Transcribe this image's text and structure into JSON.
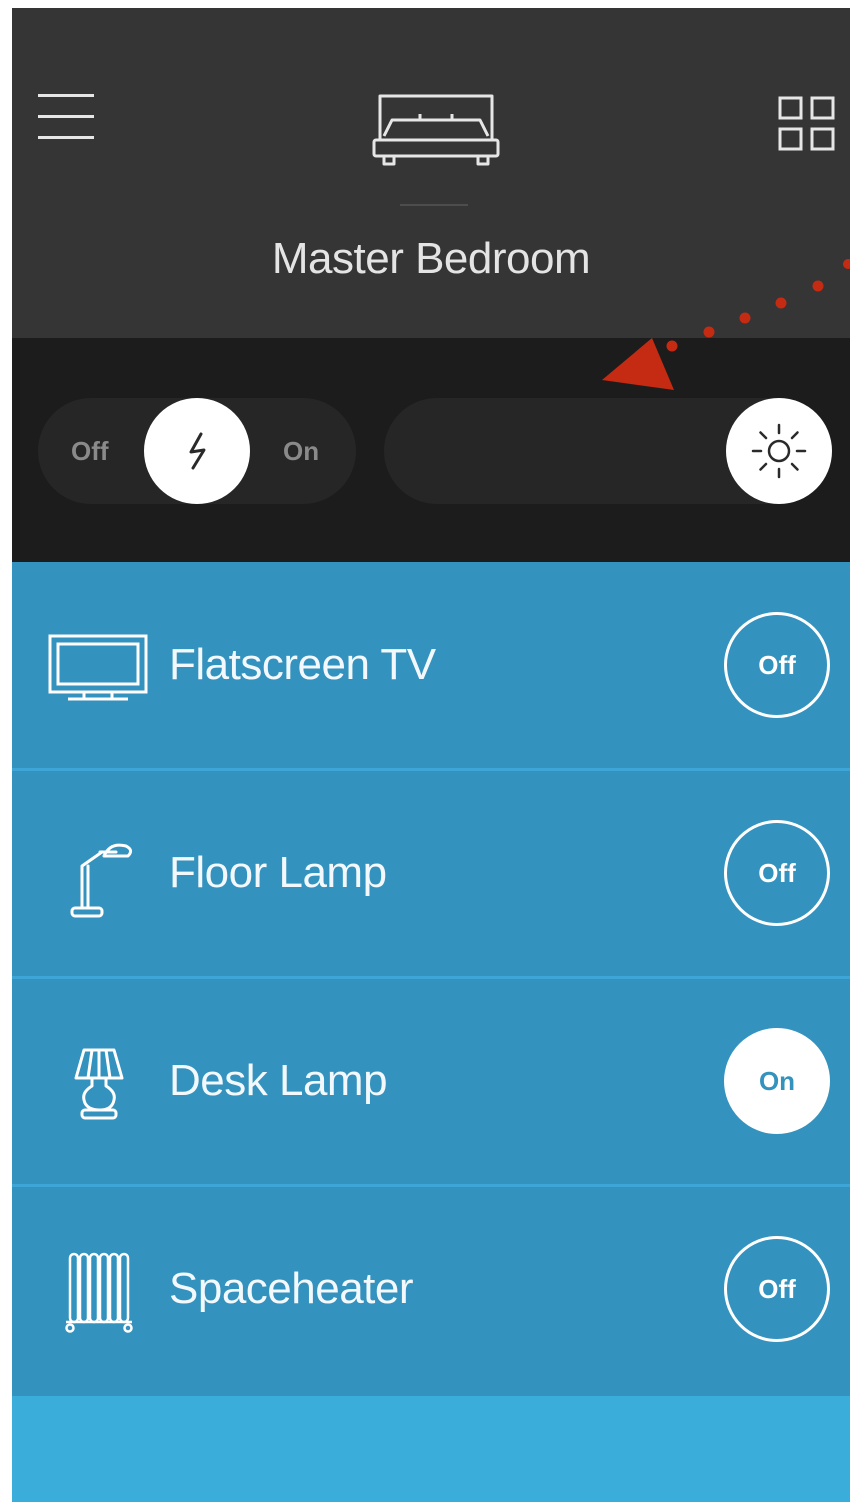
{
  "header": {
    "room_name": "Master Bedroom"
  },
  "controls": {
    "power_off_label": "Off",
    "power_on_label": "On"
  },
  "devices": [
    {
      "label": "Flatscreen TV",
      "state": "Off",
      "icon": "tv-icon"
    },
    {
      "label": "Floor Lamp",
      "state": "Off",
      "icon": "floor-lamp-icon"
    },
    {
      "label": "Desk Lamp",
      "state": "On",
      "icon": "desk-lamp-icon"
    },
    {
      "label": "Spaceheater",
      "state": "Off",
      "icon": "spaceheater-icon"
    }
  ],
  "colors": {
    "header_bg": "#353535",
    "control_bar_bg": "#1c1c1c",
    "list_bg": "#3392be",
    "footer_bg": "#3baddb",
    "annotation_arrow": "#c42b12"
  }
}
